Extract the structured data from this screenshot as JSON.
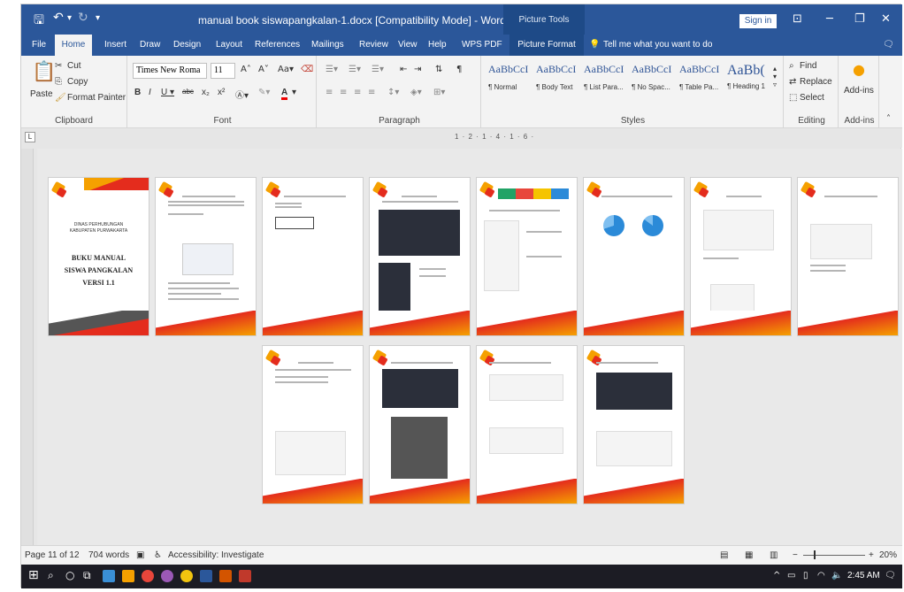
{
  "window": {
    "title": "manual book siswapangkalan-1.docx [Compatibility Mode]  -  Word",
    "context_tab": "Picture Tools",
    "sign_in": "Sign in"
  },
  "menu": {
    "tabs": [
      "File",
      "Home",
      "Insert",
      "Draw",
      "Design",
      "Layout",
      "References",
      "Mailings",
      "Review",
      "View",
      "Help",
      "WPS PDF",
      "Picture Format"
    ],
    "tell_me": "Tell me what you want to do"
  },
  "ribbon": {
    "clipboard": {
      "paste": "Paste",
      "cut": "Cut",
      "copy": "Copy",
      "format_painter": "Format Painter",
      "label": "Clipboard"
    },
    "font": {
      "name": "Times New Roma",
      "size": "11",
      "label": "Font"
    },
    "paragraph": {
      "label": "Paragraph"
    },
    "styles": {
      "label": "Styles",
      "items": [
        {
          "preview": "AaBbCcI",
          "name": "¶ Normal"
        },
        {
          "preview": "AaBbCcI",
          "name": "¶ Body Text"
        },
        {
          "preview": "AaBbCcI",
          "name": "¶ List Para..."
        },
        {
          "preview": "AaBbCcI",
          "name": "¶ No Spac..."
        },
        {
          "preview": "AaBbCcI",
          "name": "¶ Table Pa..."
        },
        {
          "preview": "AaBb(",
          "name": "¶ Heading 1"
        }
      ]
    },
    "editing": {
      "find": "Find",
      "replace": "Replace",
      "select": "Select",
      "label": "Editing"
    },
    "addins": {
      "button": "Add-ins",
      "label": "Add-ins"
    }
  },
  "ruler": {
    "text": "1 · 2 · 1 · 4 · 1 · 6 ·"
  },
  "cover": {
    "org1": "DINAS PERHUBUNGAN",
    "org2": "KABUPATEN PURWAKARTA",
    "title1": "BUKU MANUAL",
    "title2": "SISWA PANGKALAN",
    "title3": "VERSI 1.1"
  },
  "status": {
    "page": "Page 11 of 12",
    "words": "704 words",
    "accessibility": "Accessibility: Investigate",
    "zoom": "20%"
  },
  "taskbar": {
    "time": "2:45 AM"
  },
  "colors": {
    "word_blue": "#2b579a",
    "accent_orange": "#f5a000",
    "accent_red": "#e42c1d"
  }
}
